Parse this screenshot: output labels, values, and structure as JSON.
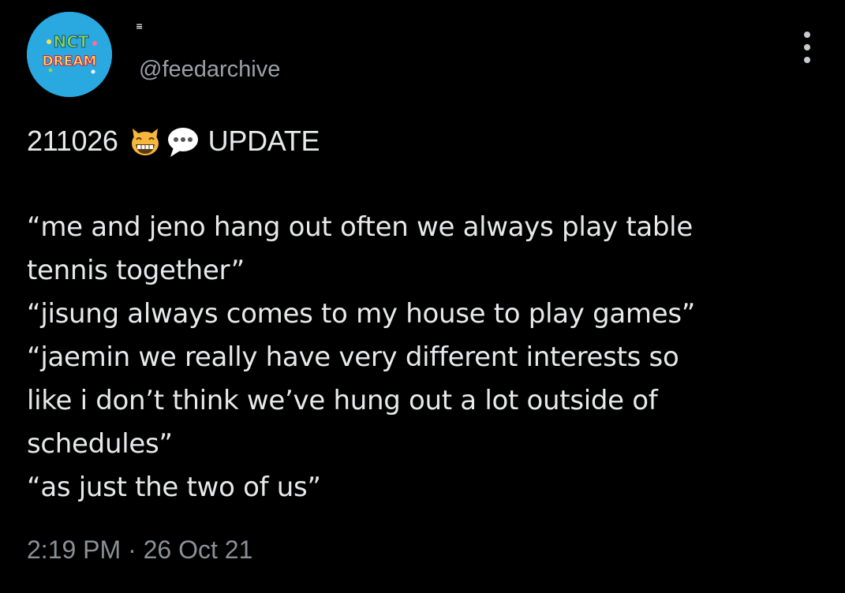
{
  "author": {
    "display_name": "≡",
    "handle": "@feedarchive",
    "avatar_icon": "nct-dream-logo",
    "avatar_color": "#29a9e0",
    "avatar_text_top": "NCT",
    "avatar_text_bottom": "DREAM"
  },
  "menu": {
    "icon": "more-vertical-icon"
  },
  "tweet": {
    "date_code": "211026",
    "emoji_1": "grinning-cat-icon",
    "emoji_2": "speech-bubble-icon",
    "label": "UPDATE",
    "lines": [
      "“me and jeno hang out often we always play table",
      "tennis together”",
      "“jisung always comes to my house to play games”",
      "“jaemin we really have very different interests so",
      "like i don’t think we’ve hung out a lot outside of",
      "schedules”",
      "“as just the two of us”"
    ]
  },
  "meta": {
    "time": "2:19 PM",
    "separator": "·",
    "date": "26 Oct 21"
  },
  "colors": {
    "background": "#000000",
    "text": "#e7e9ea",
    "secondary": "#8b9096"
  }
}
